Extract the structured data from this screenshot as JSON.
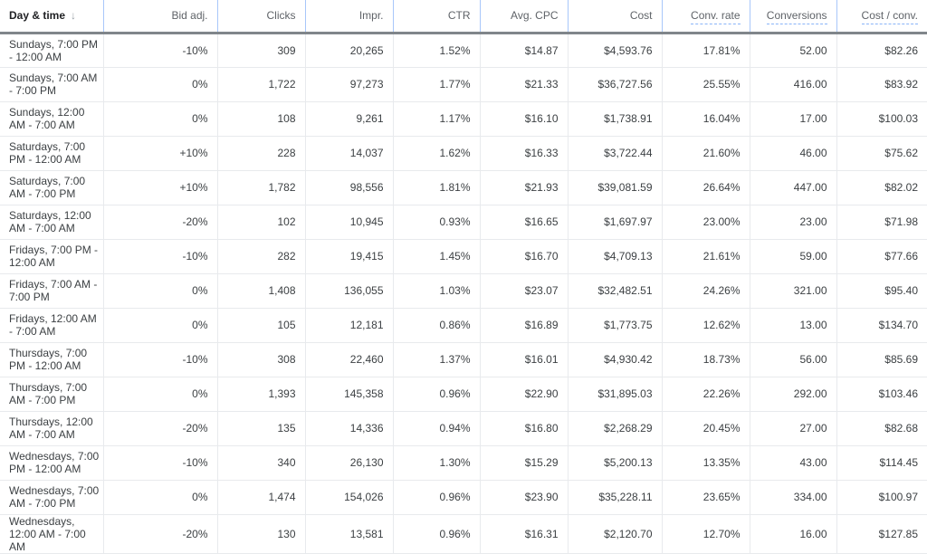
{
  "headers": [
    {
      "label": "Day & time",
      "sort": "arrow-down-icon"
    },
    {
      "label": "Bid adj."
    },
    {
      "label": "Clicks"
    },
    {
      "label": "Impr."
    },
    {
      "label": "CTR"
    },
    {
      "label": "Avg. CPC"
    },
    {
      "label": "Cost"
    },
    {
      "label": "Conv. rate",
      "dotted": true
    },
    {
      "label": "Conversions",
      "dotted": true
    },
    {
      "label": "Cost / conv.",
      "dotted": true
    }
  ],
  "sort_glyph": "↓",
  "rows": [
    [
      "Sundays, 7:00 PM - 12:00 AM",
      "-10%",
      "309",
      "20,265",
      "1.52%",
      "$14.87",
      "$4,593.76",
      "17.81%",
      "52.00",
      "$82.26"
    ],
    [
      "Sundays, 7:00 AM - 7:00 PM",
      "0%",
      "1,722",
      "97,273",
      "1.77%",
      "$21.33",
      "$36,727.56",
      "25.55%",
      "416.00",
      "$83.92"
    ],
    [
      "Sundays, 12:00 AM - 7:00 AM",
      "0%",
      "108",
      "9,261",
      "1.17%",
      "$16.10",
      "$1,738.91",
      "16.04%",
      "17.00",
      "$100.03"
    ],
    [
      "Saturdays, 7:00 PM - 12:00 AM",
      "+10%",
      "228",
      "14,037",
      "1.62%",
      "$16.33",
      "$3,722.44",
      "21.60%",
      "46.00",
      "$75.62"
    ],
    [
      "Saturdays, 7:00 AM - 7:00 PM",
      "+10%",
      "1,782",
      "98,556",
      "1.81%",
      "$21.93",
      "$39,081.59",
      "26.64%",
      "447.00",
      "$82.02"
    ],
    [
      "Saturdays, 12:00 AM - 7:00 AM",
      "-20%",
      "102",
      "10,945",
      "0.93%",
      "$16.65",
      "$1,697.97",
      "23.00%",
      "23.00",
      "$71.98"
    ],
    [
      "Fridays, 7:00 PM - 12:00 AM",
      "-10%",
      "282",
      "19,415",
      "1.45%",
      "$16.70",
      "$4,709.13",
      "21.61%",
      "59.00",
      "$77.66"
    ],
    [
      "Fridays, 7:00 AM - 7:00 PM",
      "0%",
      "1,408",
      "136,055",
      "1.03%",
      "$23.07",
      "$32,482.51",
      "24.26%",
      "321.00",
      "$95.40"
    ],
    [
      "Fridays, 12:00 AM - 7:00 AM",
      "0%",
      "105",
      "12,181",
      "0.86%",
      "$16.89",
      "$1,773.75",
      "12.62%",
      "13.00",
      "$134.70"
    ],
    [
      "Thursdays, 7:00 PM - 12:00 AM",
      "-10%",
      "308",
      "22,460",
      "1.37%",
      "$16.01",
      "$4,930.42",
      "18.73%",
      "56.00",
      "$85.69"
    ],
    [
      "Thursdays, 7:00 AM - 7:00 PM",
      "0%",
      "1,393",
      "145,358",
      "0.96%",
      "$22.90",
      "$31,895.03",
      "22.26%",
      "292.00",
      "$103.46"
    ],
    [
      "Thursdays, 12:00 AM - 7:00 AM",
      "-20%",
      "135",
      "14,336",
      "0.94%",
      "$16.80",
      "$2,268.29",
      "20.45%",
      "27.00",
      "$82.68"
    ],
    [
      "Wednesdays, 7:00 PM - 12:00 AM",
      "-10%",
      "340",
      "26,130",
      "1.30%",
      "$15.29",
      "$5,200.13",
      "13.35%",
      "43.00",
      "$114.45"
    ],
    [
      "Wednesdays, 7:00 AM - 7:00 PM",
      "0%",
      "1,474",
      "154,026",
      "0.96%",
      "$23.90",
      "$35,228.11",
      "23.65%",
      "334.00",
      "$100.97"
    ],
    [
      "Wednesdays, 12:00 AM - 7:00 AM",
      "-20%",
      "130",
      "13,581",
      "0.96%",
      "$16.31",
      "$2,120.70",
      "12.70%",
      "16.00",
      "$127.85"
    ]
  ]
}
